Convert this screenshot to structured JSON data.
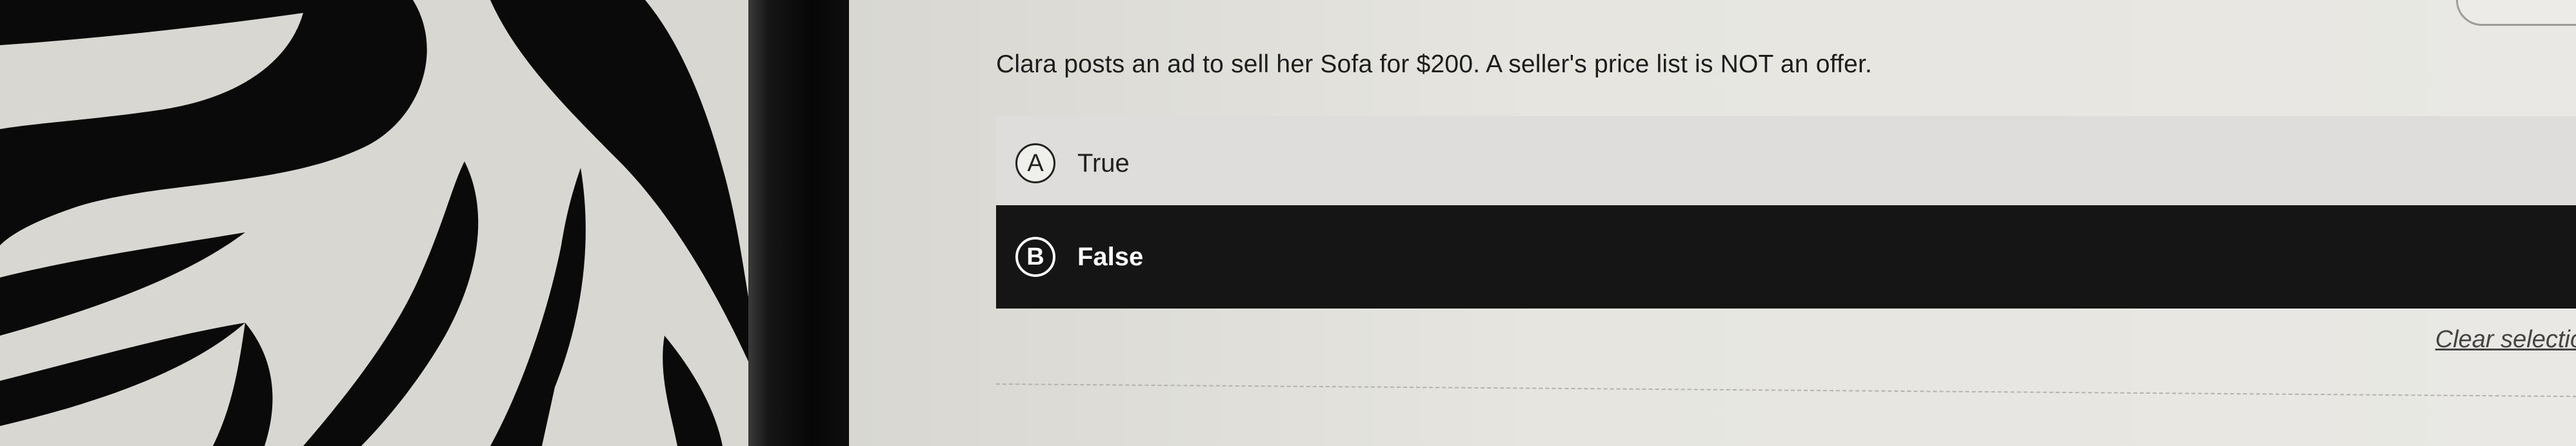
{
  "question": {
    "text": "Clara posts an ad to sell her Sofa for $200. A seller's price list is NOT an offer."
  },
  "options": [
    {
      "letter": "A",
      "label": "True",
      "selected": false
    },
    {
      "letter": "B",
      "label": "False",
      "selected": true
    }
  ],
  "clear_selection": {
    "label": "Clear selectio"
  },
  "colors": {
    "selected_bg": "#151515",
    "unselected_bg": "#dedddb",
    "page_bg": "#e6e5e0"
  }
}
